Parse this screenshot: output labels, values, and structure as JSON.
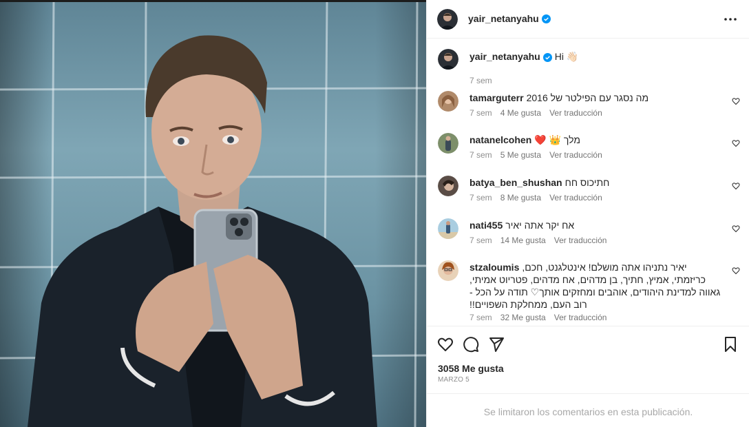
{
  "post": {
    "author": "yair_netanyahu",
    "more_icon": "more-horizontal-icon",
    "likes": "3058 Me gusta",
    "date": "MARZO 5",
    "comments_limited": "Se limitaron los comentarios en esta publicación."
  },
  "caption": {
    "user": "yair_netanyahu",
    "text": "Hi 👋🏻",
    "time": "7 sem"
  },
  "comments": [
    {
      "user": "tamarguterr",
      "text": "מה נסגר עם הפילטר של 2016",
      "time": "7 sem",
      "likes": "4 Me gusta",
      "translate": "Ver traducción"
    },
    {
      "user": "natanelcohen",
      "text": "מלך 👑 ❤️",
      "time": "7 sem",
      "likes": "5 Me gusta",
      "translate": "Ver traducción"
    },
    {
      "user": "batya_ben_shushan",
      "text": "חתיכוס חח",
      "time": "7 sem",
      "likes": "8 Me gusta",
      "translate": "Ver traducción"
    },
    {
      "user": "nati455",
      "text": "אח יקר אתה יאיר",
      "time": "7 sem",
      "likes": "14 Me gusta",
      "translate": "Ver traducción"
    },
    {
      "user": "stzaloumis",
      "text": "יאיר נתניהו אתה מושלם! אינטלגנט, חכם, כריזמתי, אמיץ, חתיך, בן מדהים, אח מדהים, פטריוט אמיתי, גאווה למדינת היהודים, אוהבים ומחזקים אותך♡ תודה על הכל - רוב העם, ממחלקת השפויים!!",
      "time": "7 sem",
      "likes": "32 Me gusta",
      "translate": "Ver traducción"
    }
  ],
  "icons": {
    "like": "heart-icon",
    "comment": "comment-icon",
    "share": "share-icon",
    "save": "bookmark-icon",
    "verified": "verified-badge-icon"
  },
  "colors": {
    "verified": "#0095f6",
    "text": "#262626",
    "muted": "#8e8e8e"
  }
}
